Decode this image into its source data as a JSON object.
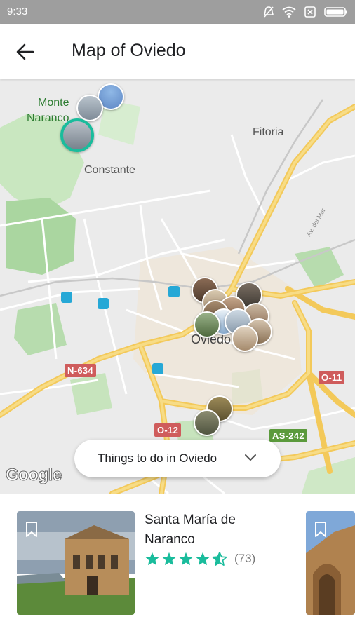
{
  "status_bar": {
    "time": "9:33"
  },
  "header": {
    "title": "Map of Oviedo"
  },
  "map": {
    "places": {
      "monte_naranco": "Monte Naranco",
      "fitoria": "Fitoria",
      "constante": "Constante",
      "oviedo": "Oviedo"
    },
    "road_labels": {
      "n634": "N-634",
      "o11": "O-11",
      "o12": "O-12",
      "as242": "AS-242"
    },
    "street_label": "Av. del Mar",
    "filter": {
      "label": "Things to do in Oviedo"
    },
    "attribution": "Google"
  },
  "cards": [
    {
      "title": "Santa María de Naranco",
      "rating": 4.5,
      "review_count": "(73)"
    }
  ],
  "colors": {
    "accent_teal": "#1abc9c",
    "road_yellow": "#f7d36b"
  }
}
